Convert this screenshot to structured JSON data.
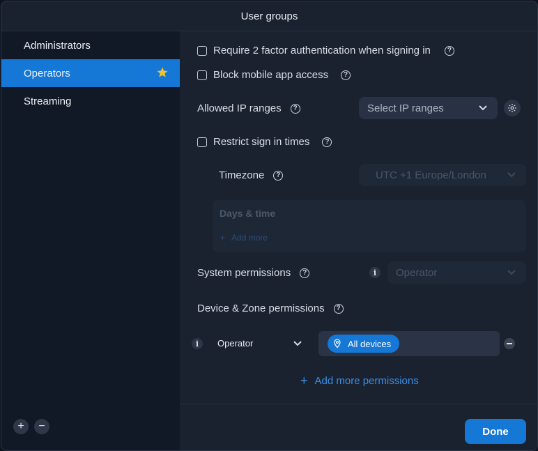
{
  "window": {
    "title": "User groups"
  },
  "sidebar": {
    "items": [
      {
        "label": "Administrators"
      },
      {
        "label": "Operators",
        "icon": "star-icon"
      },
      {
        "label": "Streaming"
      }
    ],
    "add_label": "+",
    "remove_label": "−"
  },
  "settings": {
    "twofa_label": "Require 2 factor authentication when signing in",
    "mobile_label": "Block mobile app access",
    "ip_label": "Allowed IP ranges",
    "ip_placeholder": "Select IP ranges",
    "restrict_label": "Restrict sign in times",
    "timezone_label": "Timezone",
    "timezone_value": "UTC +1 Europe/London",
    "days_time_label": "Days & time",
    "add_more_label": "Add more",
    "sysperm_label": "System permissions",
    "sysperm_value": "Operator",
    "devperm_label": "Device & Zone permissions",
    "perm_role_value": "Operator",
    "perm_chip_label": "All devices",
    "add_perm_label": "Add more permissions"
  },
  "footer": {
    "done_label": "Done"
  },
  "colors": {
    "accent": "#1577d6",
    "star": "#f2c230",
    "link": "#3a8ee6"
  }
}
